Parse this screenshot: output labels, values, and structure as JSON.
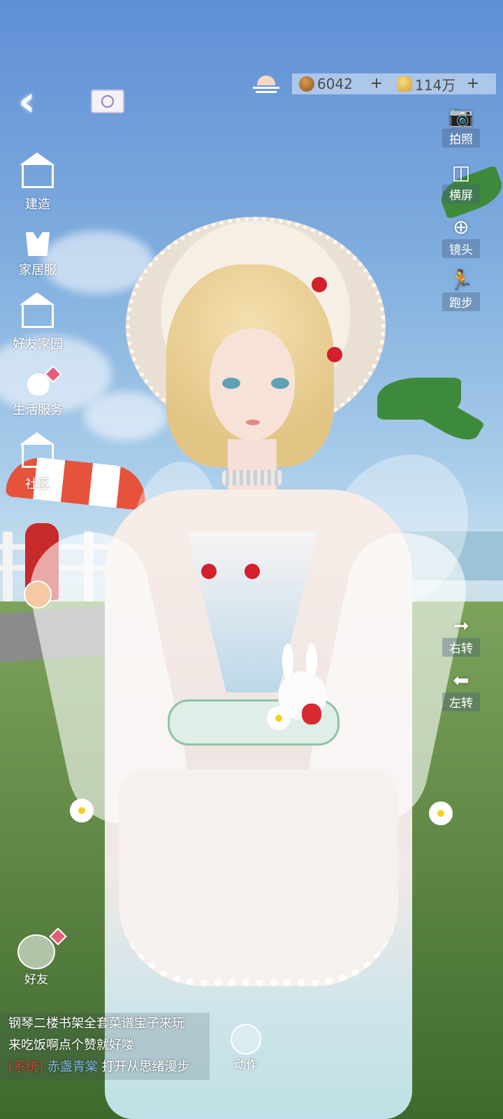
{
  "hud": {
    "back_icon": "back-chevron-icon",
    "mail_icon": "mail-icon",
    "weather_icon": "sunset-weather-icon",
    "currency": [
      {
        "icon": "acorn-coin-icon",
        "amount": "6042",
        "add": "+"
      },
      {
        "icon": "gold-shield-coin-icon",
        "amount": "114万",
        "add": "+"
      }
    ]
  },
  "left_menu": [
    {
      "label": "建造",
      "icon": "build-icon"
    },
    {
      "label": "家居服",
      "icon": "home-wear-icon"
    },
    {
      "label": "好友家园",
      "icon": "friend-home-icon"
    },
    {
      "label": "生活服务",
      "icon": "life-service-icon"
    },
    {
      "label": "社区",
      "icon": "community-icon"
    }
  ],
  "right_menu": {
    "top": [
      {
        "label": "拍照",
        "icon": "camera-icon"
      },
      {
        "label": "横屏",
        "icon": "landscape-icon"
      },
      {
        "label": "镜头",
        "icon": "lens-icon"
      },
      {
        "label": "跑步",
        "icon": "run-icon"
      }
    ],
    "rotate": [
      {
        "label": "右转",
        "icon": "arrow-right-icon"
      },
      {
        "label": "左转",
        "icon": "arrow-left-icon"
      }
    ]
  },
  "chat": {
    "line1": "钢琴二楼书架全套菜谱宝子来玩",
    "line2": "来吃饭啊点个赞就好喽",
    "system_tag": "[系统]",
    "user": "赤盏青棠",
    "message": "打开从思绪漫步"
  },
  "bottom": {
    "friend_label": "好友",
    "action_label": "动作"
  },
  "colors": {
    "system_tag": "#d6443c",
    "username": "#7fb6e6",
    "sky_top": "#5f8fd6"
  }
}
